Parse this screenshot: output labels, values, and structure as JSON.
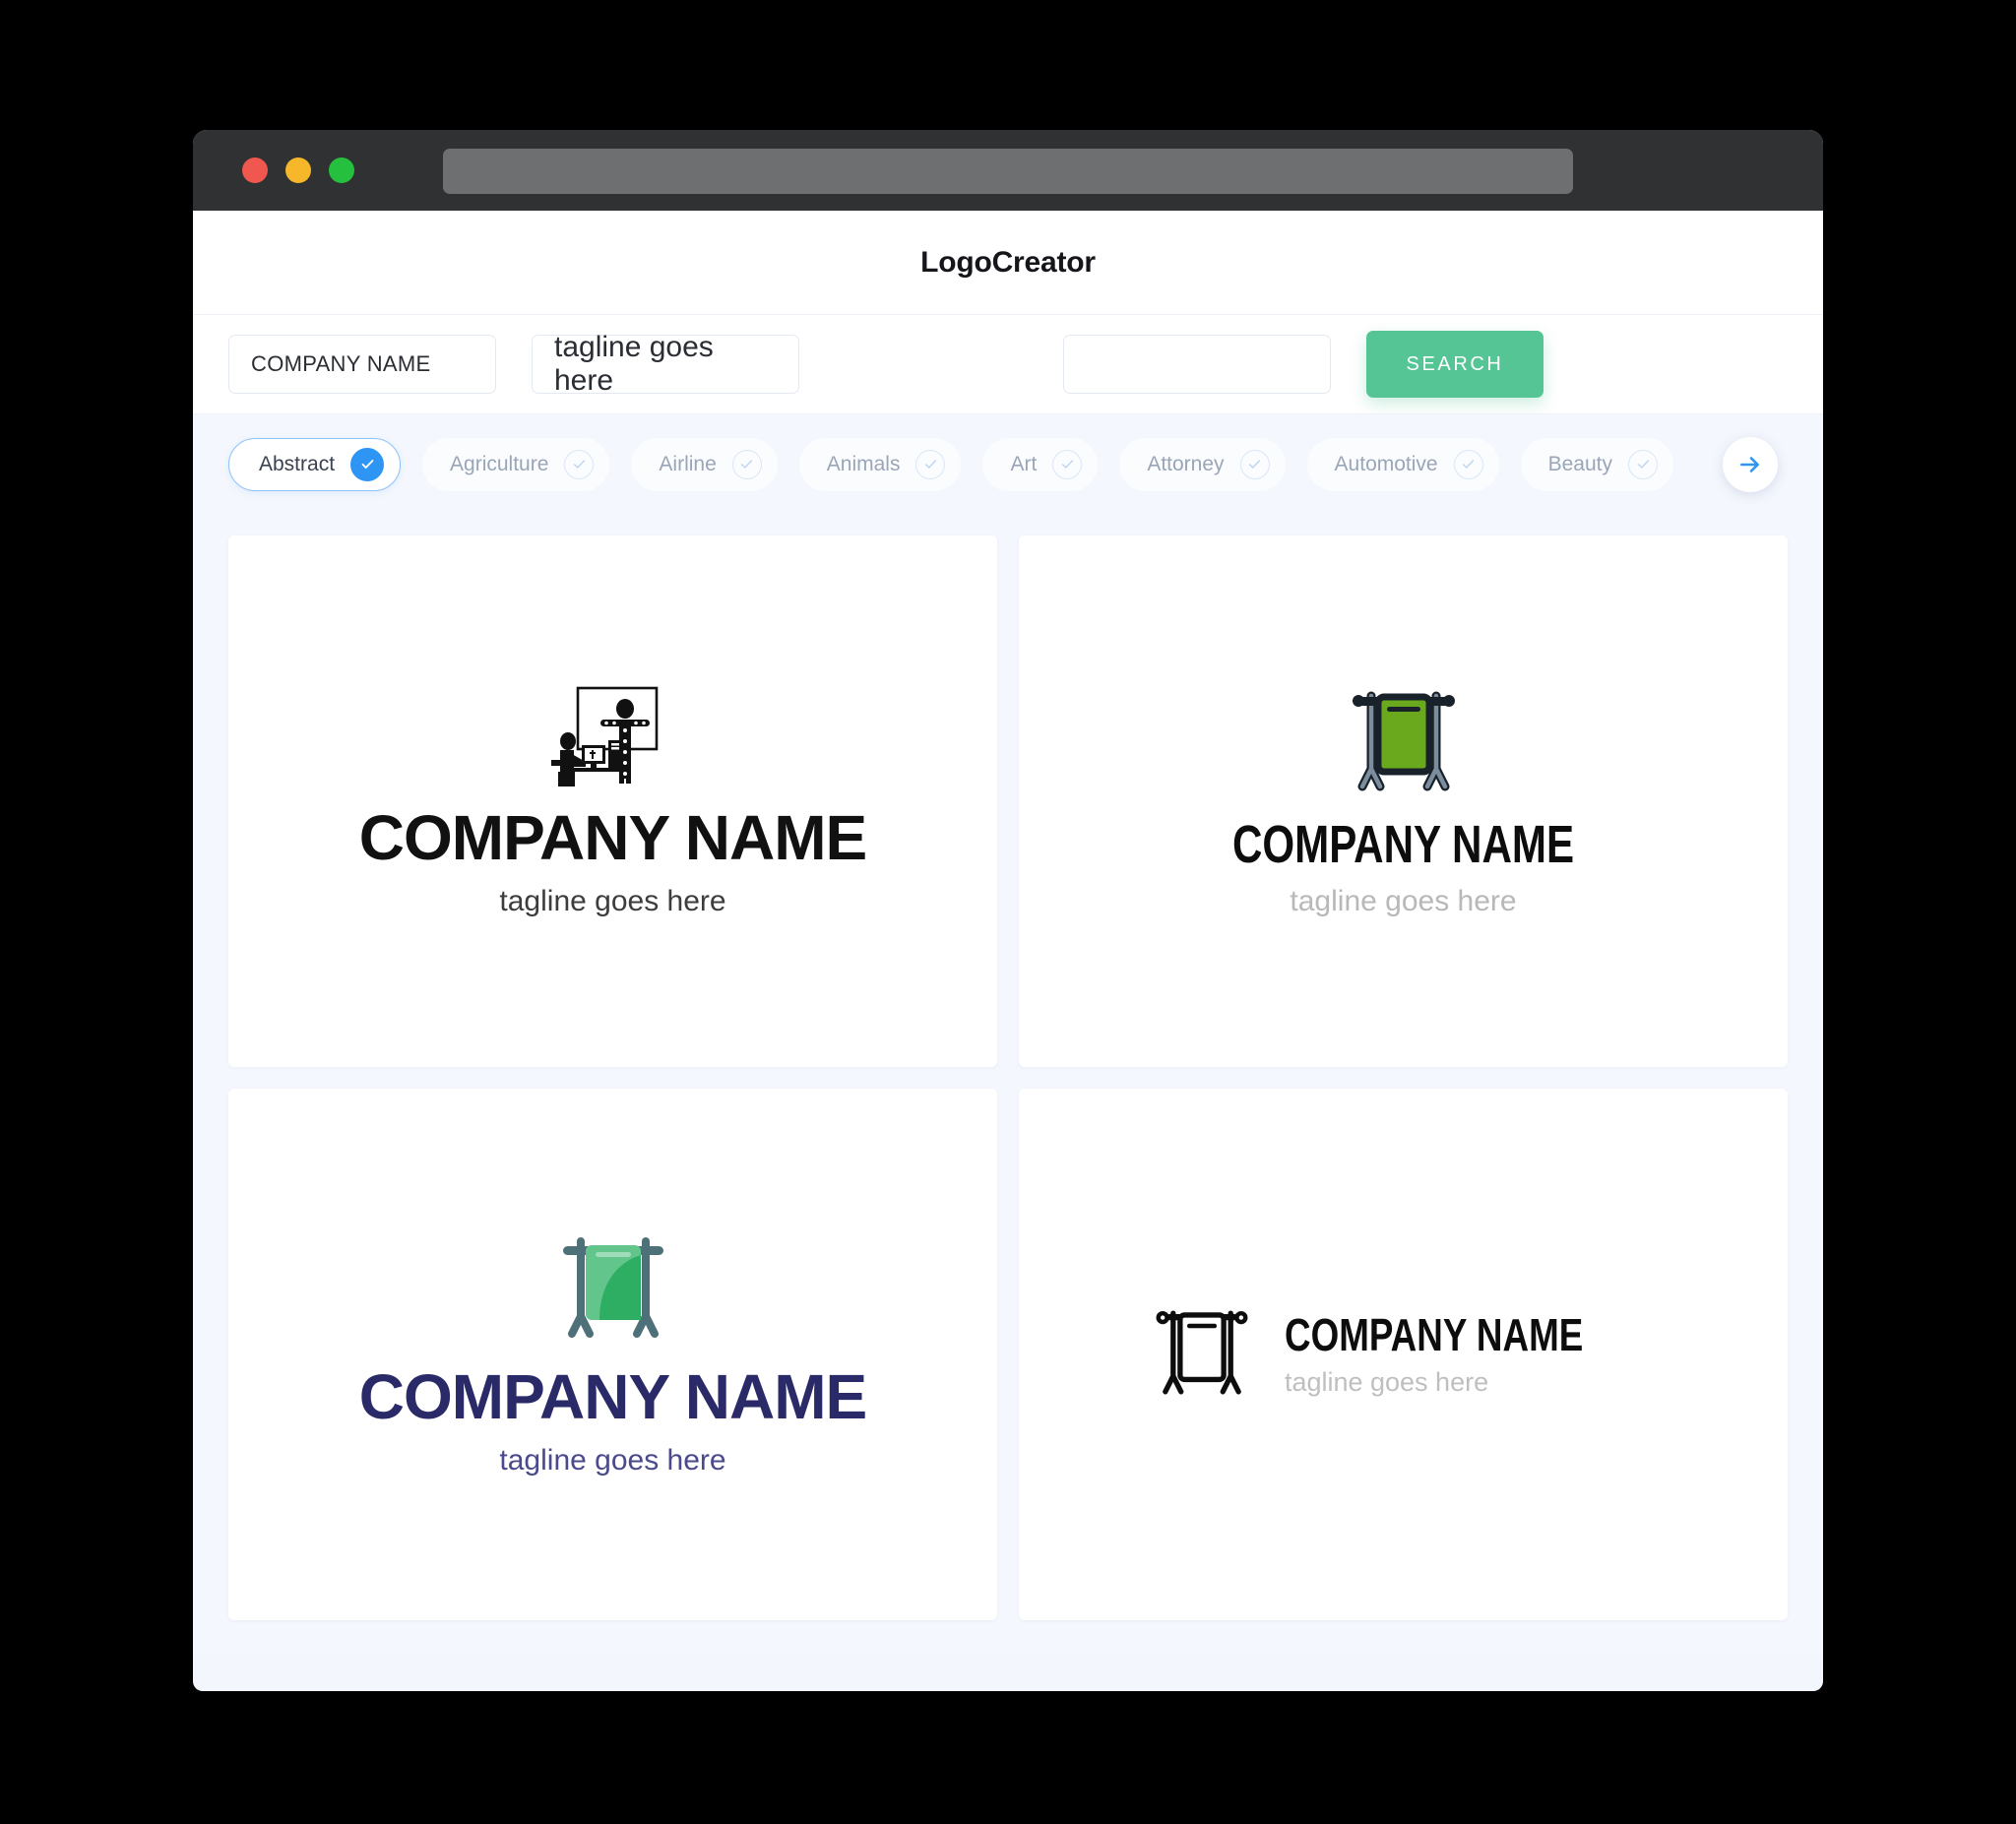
{
  "window": {
    "titlebar": {
      "traffic_lights": [
        {
          "name": "close",
          "color": "#f0574f"
        },
        {
          "name": "minimize",
          "color": "#f6b82a"
        },
        {
          "name": "maximize",
          "color": "#25c03d"
        }
      ],
      "url_value": ""
    }
  },
  "header": {
    "title": "LogoCreator"
  },
  "search": {
    "company_value": "COMPANY NAME",
    "company_placeholder": "COMPANY NAME",
    "tagline_value": "tagline goes here",
    "tagline_placeholder": "tagline goes here",
    "extra_value": "",
    "extra_placeholder": "",
    "button_label": "SEARCH",
    "button_color": "#55c596"
  },
  "categories": {
    "accent_color": "#2f95f5",
    "items": [
      {
        "label": "Abstract",
        "selected": true
      },
      {
        "label": "Agriculture",
        "selected": false
      },
      {
        "label": "Airline",
        "selected": false
      },
      {
        "label": "Animals",
        "selected": false
      },
      {
        "label": "Art",
        "selected": false
      },
      {
        "label": "Attorney",
        "selected": false
      },
      {
        "label": "Automotive",
        "selected": false
      },
      {
        "label": "Beauty",
        "selected": false
      }
    ],
    "next_label": "next-arrow"
  },
  "results": [
    {
      "icon": "motion-capture-studio-icon",
      "brand": "COMPANY NAME",
      "tagline": "tagline goes here",
      "layout": "stacked",
      "brand_color": "#111111",
      "tagline_color": "#3d3d3d"
    },
    {
      "icon": "green-hanging-banner-outline-icon",
      "brand": "COMPANY NAME",
      "tagline": "tagline goes here",
      "layout": "stacked",
      "brand_color": "#0d0d0d",
      "tagline_color": "#b8b8b8",
      "banner_color": "#6aa91e"
    },
    {
      "icon": "green-hanging-banner-flat-icon",
      "brand": "COMPANY NAME",
      "tagline": "tagline goes here",
      "layout": "stacked",
      "brand_color": "#2b2a68",
      "tagline_color": "#4a4a8c",
      "banner_color": "#3cb878"
    },
    {
      "icon": "outline-hanging-banner-icon",
      "brand": "COMPANY NAME",
      "tagline": "tagline goes here",
      "layout": "horizontal",
      "brand_color": "#0d0d0d",
      "tagline_color": "#bfbfbf"
    }
  ]
}
